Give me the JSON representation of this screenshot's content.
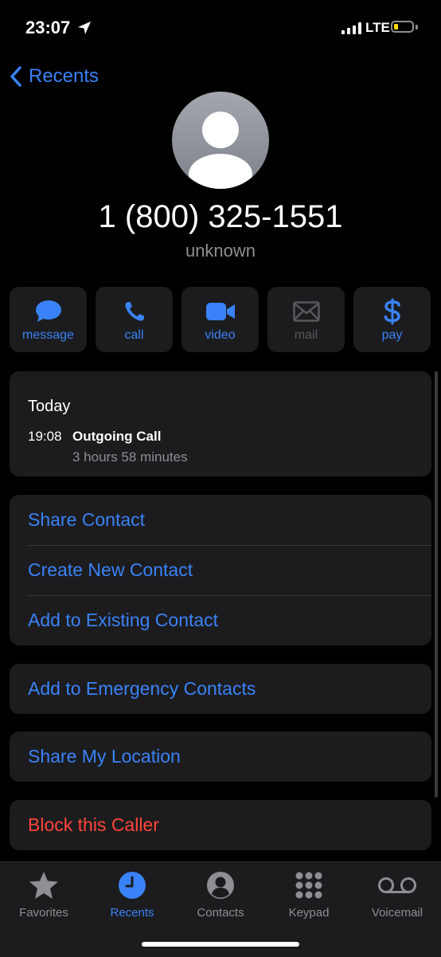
{
  "status": {
    "time": "23:07",
    "network": "LTE"
  },
  "nav": {
    "back_label": "Recents"
  },
  "contact": {
    "number": "1 (800) 325-1551",
    "label": "unknown"
  },
  "actions": [
    {
      "label": "message",
      "icon": "message-bubble-icon"
    },
    {
      "label": "call",
      "icon": "phone-icon"
    },
    {
      "label": "video",
      "icon": "video-camera-icon"
    },
    {
      "label": "mail",
      "icon": "envelope-icon",
      "disabled": true
    },
    {
      "label": "pay",
      "icon": "dollar-icon"
    }
  ],
  "history": {
    "day": "Today",
    "entries": [
      {
        "time": "19:08",
        "type": "Outgoing Call",
        "duration": "3 hours 58 minutes"
      }
    ]
  },
  "options": {
    "share_contact": "Share Contact",
    "create_new_contact": "Create New Contact",
    "add_existing": "Add to Existing Contact",
    "add_emergency": "Add to Emergency Contacts",
    "share_location": "Share My Location",
    "block": "Block this Caller"
  },
  "tabs": [
    {
      "label": "Favorites",
      "icon": "star-icon"
    },
    {
      "label": "Recents",
      "icon": "clock-icon",
      "active": true
    },
    {
      "label": "Contacts",
      "icon": "person-circle-icon"
    },
    {
      "label": "Keypad",
      "icon": "keypad-icon"
    },
    {
      "label": "Voicemail",
      "icon": "voicemail-icon"
    }
  ],
  "colors": {
    "accent": "#3a82f7",
    "destructive": "#ff453a",
    "card": "#1c1c1e",
    "secondary_text": "#8e8e93"
  }
}
